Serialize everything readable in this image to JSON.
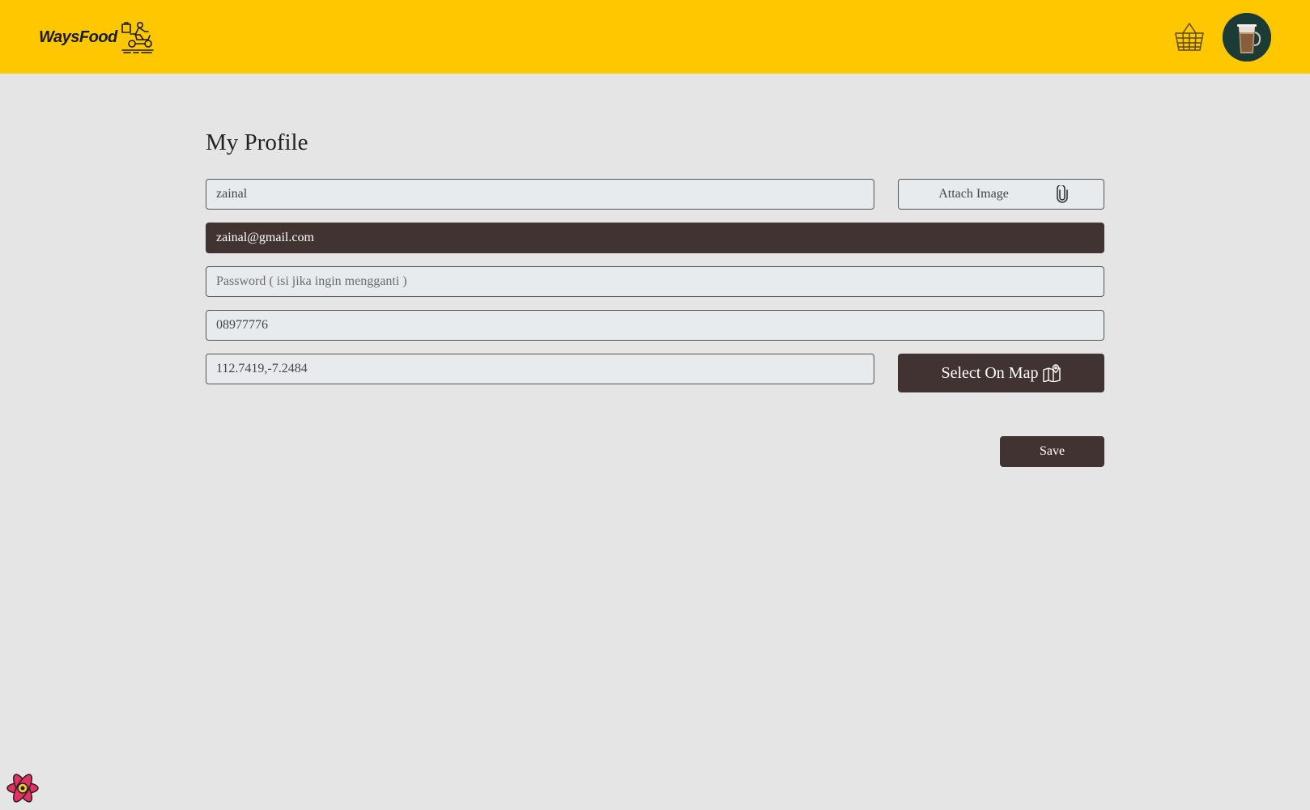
{
  "app": {
    "brand_name": "WaysFood"
  },
  "navbar": {
    "cart_icon": "basket-icon",
    "avatar_icon": "coffee-cup-avatar",
    "colors": {
      "background": "#ffc700"
    }
  },
  "profile": {
    "title": "My Profile",
    "fullname": {
      "value": "zainal",
      "placeholder": ""
    },
    "attach_image_label": "Attach Image",
    "email": {
      "value": "zainal@gmail.com"
    },
    "password": {
      "value": "",
      "placeholder": "Password ( isi jika ingin mengganti )"
    },
    "phone": {
      "value": "08977776"
    },
    "location": {
      "value": "112.7419,-7.2484"
    },
    "select_on_map_label": "Select On Map",
    "save_label": "Save"
  },
  "theme": {
    "page_background": "#e5e5e5",
    "dark_button": "#423333",
    "input_background": "#e8ebee"
  }
}
